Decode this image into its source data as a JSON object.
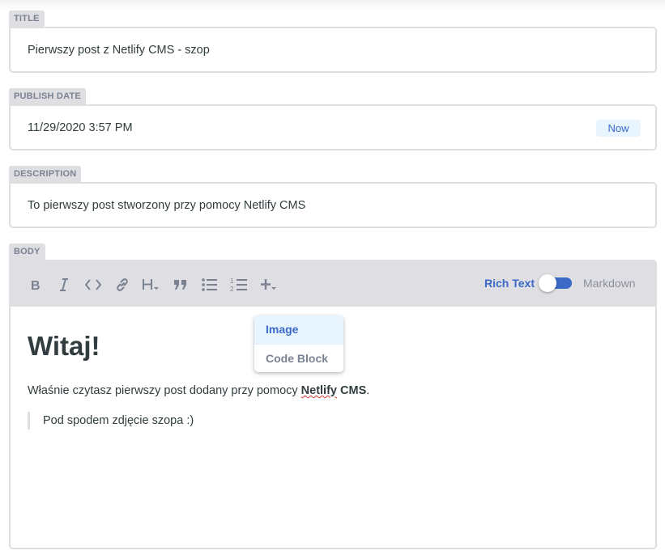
{
  "fields": {
    "title": {
      "label": "TITLE",
      "value": "Pierwszy post z Netlify CMS - szop"
    },
    "publish_date": {
      "label": "PUBLISH DATE",
      "value": "11/29/2020 3:57 PM",
      "now_label": "Now"
    },
    "description": {
      "label": "DESCRIPTION",
      "value": "To pierwszy post stworzony przy pomocy Netlify CMS"
    },
    "body": {
      "label": "BODY"
    }
  },
  "toolbar": {
    "buttons": [
      "bold-icon",
      "italic-icon",
      "code-icon",
      "link-icon",
      "heading-icon",
      "quote-icon",
      "bulleted-list-icon",
      "numbered-list-icon",
      "plus-icon"
    ],
    "rich_text_label": "Rich Text",
    "markdown_label": "Markdown",
    "mode_toggle_on": false,
    "accent_color": "#3a69c7"
  },
  "dropdown": {
    "items": [
      "Image",
      "Code Block"
    ]
  },
  "editor": {
    "heading": "Witaj!",
    "paragraph_before": "Właśnie czytasz pierwszy post dodany przy pomocy ",
    "paragraph_bold_1": "Netlify",
    "paragraph_bold_2": "CMS",
    "paragraph_after": ".",
    "blockquote": "Pod spodem zdjęcie szopa :)"
  }
}
